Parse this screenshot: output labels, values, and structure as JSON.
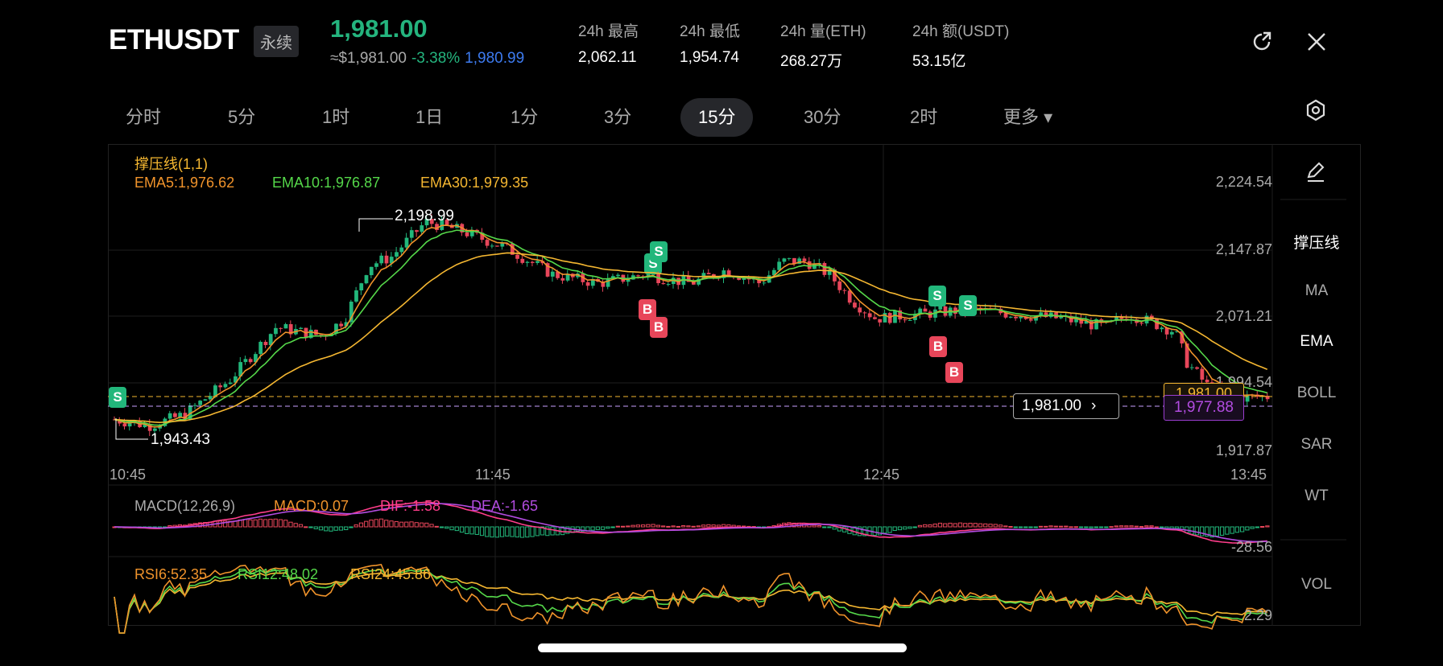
{
  "header": {
    "symbol": "ETHUSDT",
    "contract_type": "永续",
    "last_price": "1,981.00",
    "usd_price": "≈$1,981.00",
    "change_pct": "-3.38%",
    "mark_price": "1,980.99",
    "stats": [
      {
        "label": "24h  最高",
        "value": "2,062.11"
      },
      {
        "label": "24h  最低",
        "value": "1,954.74"
      },
      {
        "label": "24h  量(ETH)",
        "value": "268.27万"
      },
      {
        "label": "24h  额(USDT)",
        "value": "53.15亿"
      }
    ]
  },
  "tabs": [
    {
      "label": "分时"
    },
    {
      "label": "5分"
    },
    {
      "label": "1时"
    },
    {
      "label": "1日"
    },
    {
      "label": "1分"
    },
    {
      "label": "3分"
    },
    {
      "label": "15分",
      "active": true
    },
    {
      "label": "30分"
    },
    {
      "label": "2时"
    },
    {
      "label": "更多 ▾"
    }
  ],
  "sidebar": {
    "items": [
      "撑压线",
      "MA",
      "EMA",
      "BOLL",
      "SAR",
      "WT",
      "VOL"
    ]
  },
  "legend": {
    "indicator": "撑压线(1,1)",
    "ema5": "EMA5:1,976.62",
    "ema10": "EMA10:1,976.87",
    "ema30": "EMA30:1,979.35",
    "macd_title": "MACD(12,26,9)",
    "macd": "MACD:0.07",
    "dif": "DIF:-1.58",
    "dea": "DEA:-1.65",
    "macd_axis": "-28.56",
    "rsi6": "RSI6:52.35",
    "rsi12": "RSI12:48.02",
    "rsi24": "RSI24:45.86",
    "rsi_axis": "2.29"
  },
  "colors": {
    "up": "#22b77b",
    "down": "#e8465a",
    "ema5": "#f0932b",
    "ema10": "#55d84a",
    "ema30": "#f5b731",
    "dif": "#ff3d8b",
    "dea": "#b24ce0"
  },
  "chart_data": {
    "type": "candlestick",
    "price_axis": [
      "2,224.54",
      "2,147.87",
      "2,071.21",
      "1,994.54",
      "1,917.87"
    ],
    "ylim": [
      1917.87,
      2224.54
    ],
    "time_axis": [
      "10:45",
      "11:45",
      "12:45",
      "13:45"
    ],
    "high_label": "2,198.99",
    "low_label": "1,943.43",
    "high": 2198.99,
    "low": 1943.43,
    "current_price_label": "1,981.00",
    "support_label": "1,981.00",
    "ema_label": "1,977.88",
    "price_path": [
      [
        0,
        1955
      ],
      [
        0.03,
        1948
      ],
      [
        0.06,
        1960
      ],
      [
        0.1,
        2000
      ],
      [
        0.14,
        2060
      ],
      [
        0.18,
        2050
      ],
      [
        0.2,
        2070
      ],
      [
        0.22,
        2130
      ],
      [
        0.24,
        2140
      ],
      [
        0.27,
        2180
      ],
      [
        0.3,
        2170
      ],
      [
        0.34,
        2150
      ],
      [
        0.38,
        2120
      ],
      [
        0.42,
        2110
      ],
      [
        0.46,
        2120
      ],
      [
        0.5,
        2110
      ],
      [
        0.53,
        2125
      ],
      [
        0.56,
        2110
      ],
      [
        0.58,
        2135
      ],
      [
        0.6,
        2135
      ],
      [
        0.62,
        2120
      ],
      [
        0.64,
        2090
      ],
      [
        0.66,
        2070
      ],
      [
        0.7,
        2075
      ],
      [
        0.74,
        2080
      ],
      [
        0.78,
        2075
      ],
      [
        0.82,
        2070
      ],
      [
        0.86,
        2060
      ],
      [
        0.88,
        2075
      ],
      [
        0.9,
        2065
      ],
      [
        0.92,
        2055
      ],
      [
        0.93,
        2020
      ],
      [
        0.95,
        1990
      ],
      [
        0.97,
        1980
      ],
      [
        1,
        1981
      ]
    ],
    "markers": [
      {
        "type": "S",
        "label": "S"
      },
      {
        "type": "S",
        "label": "S"
      },
      {
        "type": "S",
        "label": "S"
      },
      {
        "type": "B",
        "label": "B"
      },
      {
        "type": "B",
        "label": "B"
      },
      {
        "type": "S",
        "label": "S"
      },
      {
        "type": "S",
        "label": "S"
      },
      {
        "type": "B",
        "label": "B"
      },
      {
        "type": "B",
        "label": "B"
      }
    ]
  }
}
